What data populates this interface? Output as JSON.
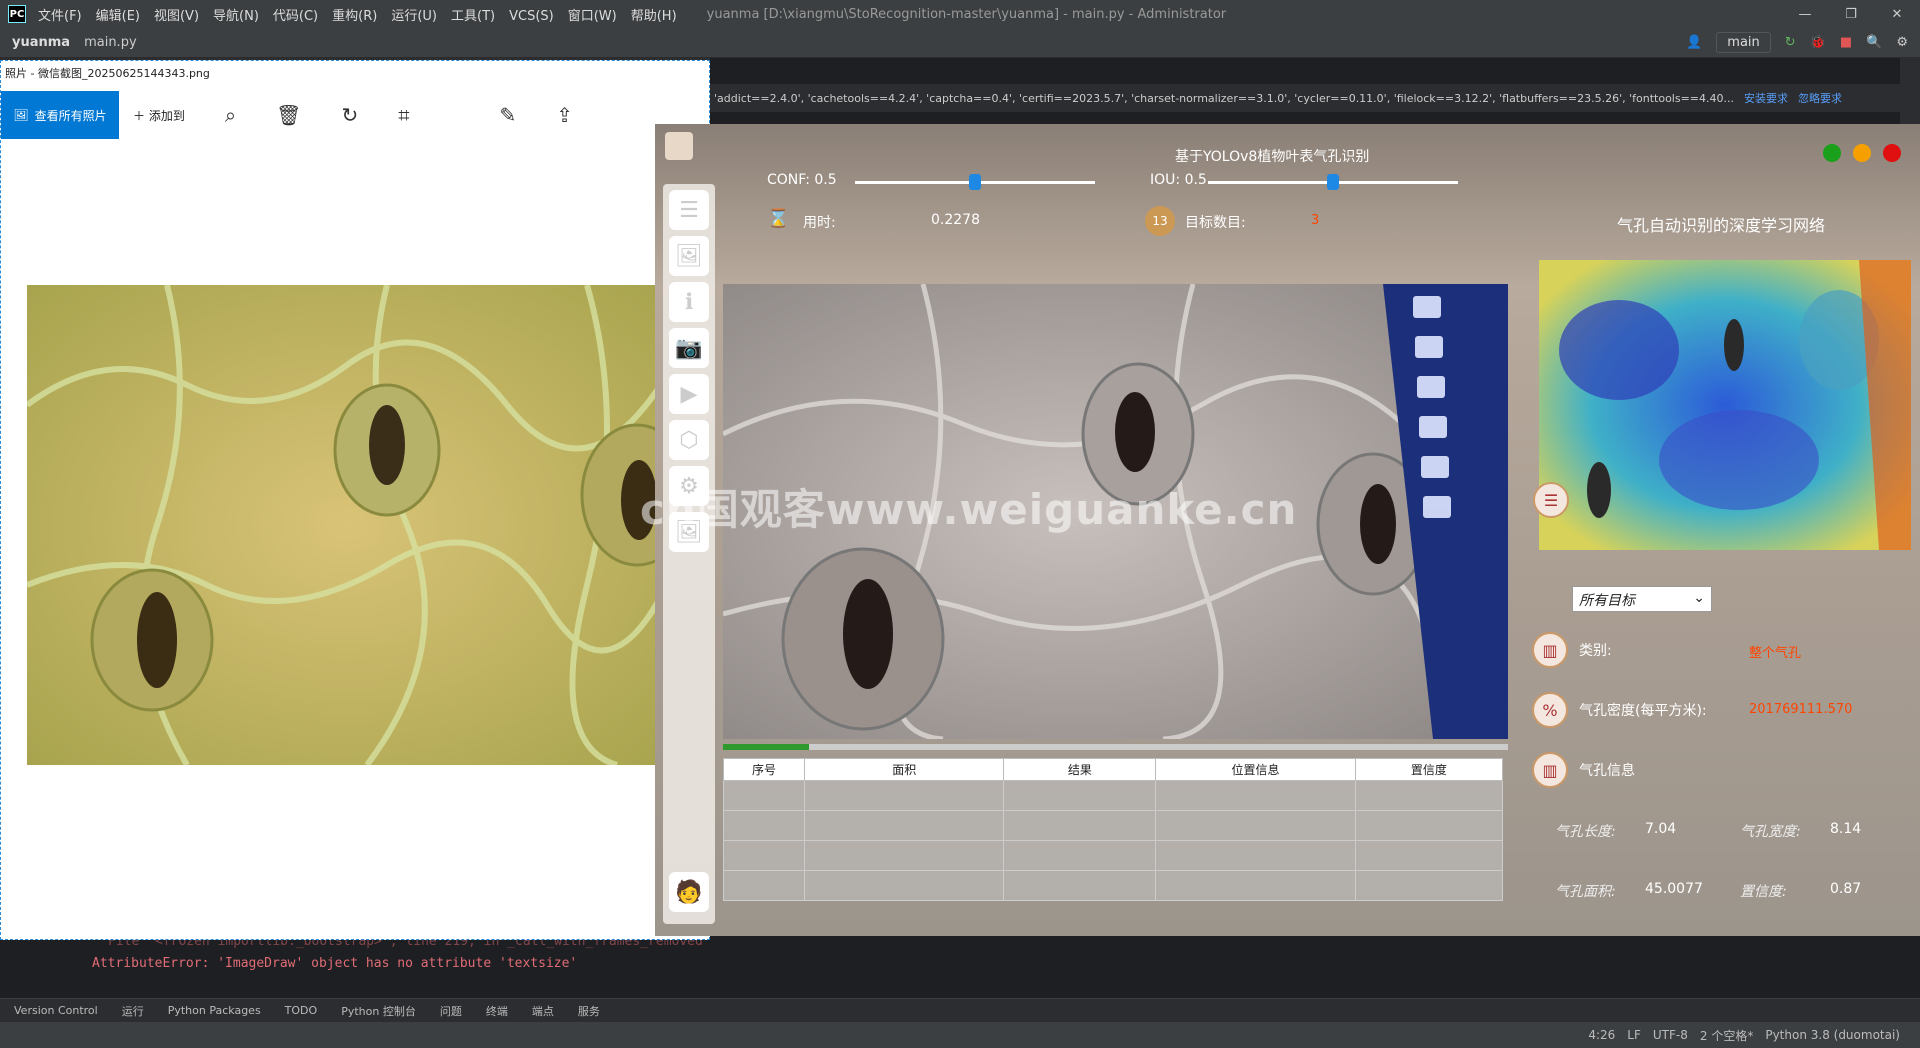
{
  "ide": {
    "menu": [
      "文件(F)",
      "编辑(E)",
      "视图(V)",
      "导航(N)",
      "代码(C)",
      "重构(R)",
      "运行(U)",
      "工具(T)",
      "VCS(S)",
      "窗口(W)",
      "帮助(H)"
    ],
    "window_title": "yuanma [D:\\xiangmu\\StoRecognition-master\\yuanma] - main.py - Administrator",
    "breadcrumb_project": "yuanma",
    "breadcrumb_file": "main.py",
    "branch": "main",
    "warn_text": "'addict==2.4.0', 'cachetools==4.2.4', 'captcha==0.4', 'certifi==2023.5.7', 'charset-normalizer==3.1.0', 'cycler==0.11.0', 'filelock==3.12.2', 'flatbuffers==23.5.26', 'fonttools==4.40...",
    "warn_install": "安装要求",
    "warn_ignore": "忽略要求",
    "run_line1": "File \"<frozen importlib._bootstrap>\", line 219, in _call_with_frames_removed",
    "run_error": "AttributeError: 'ImageDraw' object has no attribute 'textsize'",
    "tooltabs": [
      "Version Control",
      "运行",
      "Python Packages",
      "TODO",
      "Python 控制台",
      "问题",
      "终端",
      "端点",
      "服务"
    ],
    "status": [
      "4:26",
      "LF",
      "UTF-8",
      "2 个空格*",
      "Python 3.8 (duomotai)"
    ]
  },
  "photos": {
    "title": "照片 - 微信截图_20250625144343.png",
    "view_all": "查看所有照片",
    "add_to": "添加到"
  },
  "app": {
    "title": "基于YOLOv8植物叶表气孔识别",
    "conf_label": "CONF: 0.5",
    "iou_label": "IOU: 0.5",
    "conf_value": 0.5,
    "iou_value": 0.5,
    "time_label": "用时:",
    "time_value": "0.2278",
    "count_label": "目标数目:",
    "count_value": "3",
    "progress": 0.11,
    "table_headers": [
      "序号",
      "面积",
      "结果",
      "位置信息",
      "置信度"
    ],
    "right_title": "气孔自动识别的深度学习网络",
    "combo": "所有目标",
    "class_label": "类别:",
    "class_value": "整个气孔",
    "density_label": "气孔密度(每平方米):",
    "density_value": "201769111.570",
    "info_label": "气孔信息",
    "length_label": "气孔长度:",
    "length_value": "7.04",
    "width_label": "气孔宽度:",
    "width_value": "8.14",
    "area_label": "气孔面积:",
    "area_value": "45.0077",
    "conf2_label": "置信度:",
    "conf2_value": "0.87",
    "watermark": "cn国观客www.weiguanke.cn"
  }
}
